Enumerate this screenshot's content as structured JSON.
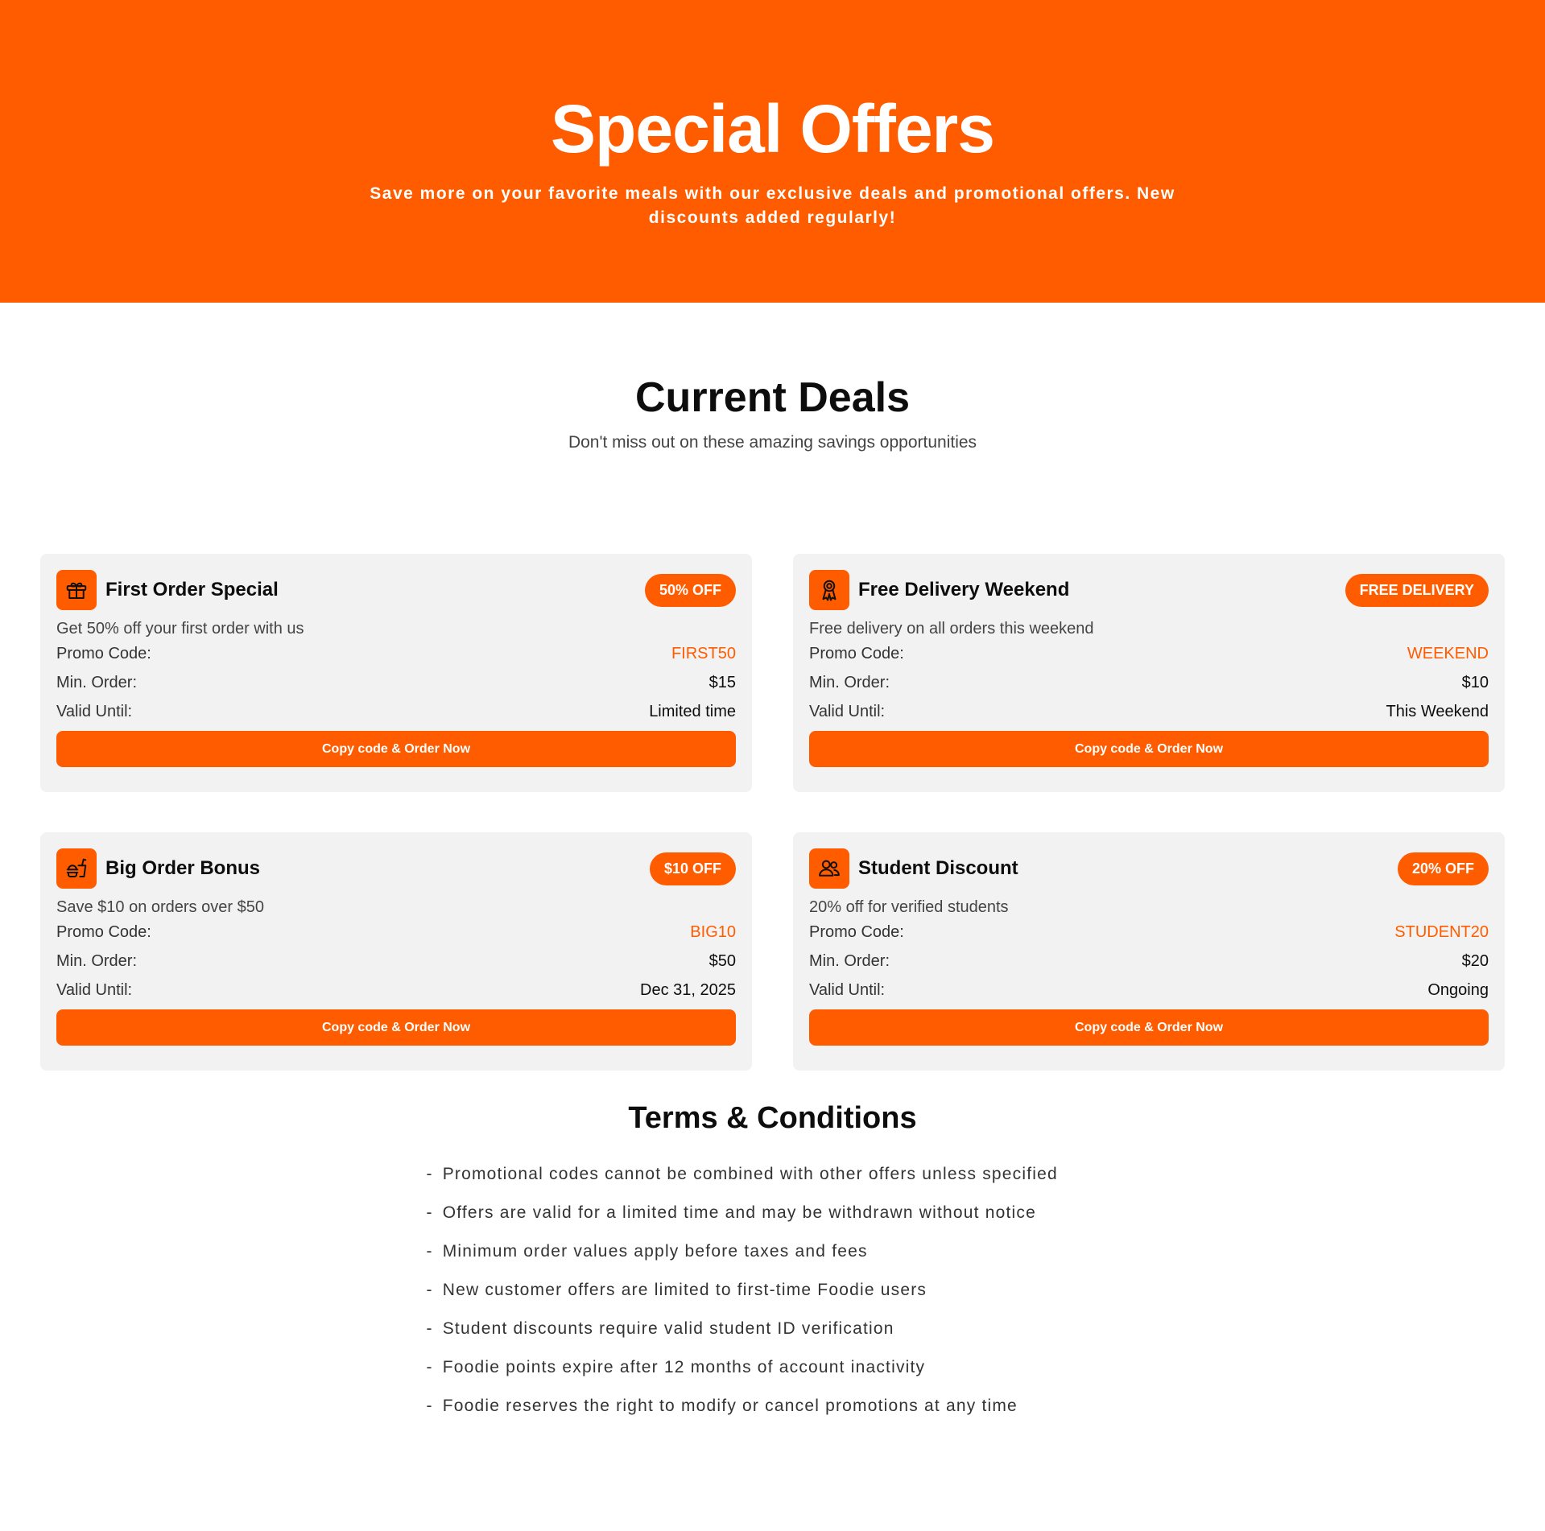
{
  "hero": {
    "title": "Special Offers",
    "subtitle": "Save more on your favorite meals with our exclusive deals and promotional offers. New discounts added regularly!"
  },
  "deals": {
    "title": "Current Deals",
    "subtitle": "Don't miss out on these amazing savings opportunities",
    "labels": {
      "promo": "Promo Code:",
      "min": "Min. Order:",
      "valid": "Valid Until:"
    },
    "button_label": "Copy code & Order Now",
    "items": [
      {
        "icon": "gift-icon",
        "title": "First Order Special",
        "badge": "50% OFF",
        "description": "Get 50% off your first order with us",
        "promo_code": "FIRST50",
        "min_order": "$15",
        "valid_until": "Limited time"
      },
      {
        "icon": "award-icon",
        "title": "Free Delivery Weekend",
        "badge": "FREE DELIVERY",
        "description": "Free delivery on all orders this weekend",
        "promo_code": "WEEKEND",
        "min_order": "$10",
        "valid_until": "This Weekend"
      },
      {
        "icon": "food-icon",
        "title": "Big Order Bonus",
        "badge": "$10 OFF",
        "description": "Save $10 on orders over $50",
        "promo_code": "BIG10",
        "min_order": "$50",
        "valid_until": "Dec 31, 2025"
      },
      {
        "icon": "users-icon",
        "title": "Student Discount",
        "badge": "20% OFF",
        "description": "20% off for verified students",
        "promo_code": "STUDENT20",
        "min_order": "$20",
        "valid_until": "Ongoing"
      }
    ]
  },
  "terms": {
    "title": "Terms & Conditions",
    "bullet": "-",
    "items": [
      "Promotional codes cannot be combined with other offers unless specified",
      "Offers are valid for a limited time and may be withdrawn without notice",
      "Minimum order values apply before taxes and fees",
      "New customer offers are limited to first-time Foodie users",
      "Student discounts require valid student ID verification",
      "Foodie points expire after 12 months of account inactivity",
      "Foodie reserves the right to modify or cancel promotions at any time"
    ]
  },
  "colors": {
    "accent": "#ff5c00",
    "card_bg": "#f2f2f2"
  }
}
